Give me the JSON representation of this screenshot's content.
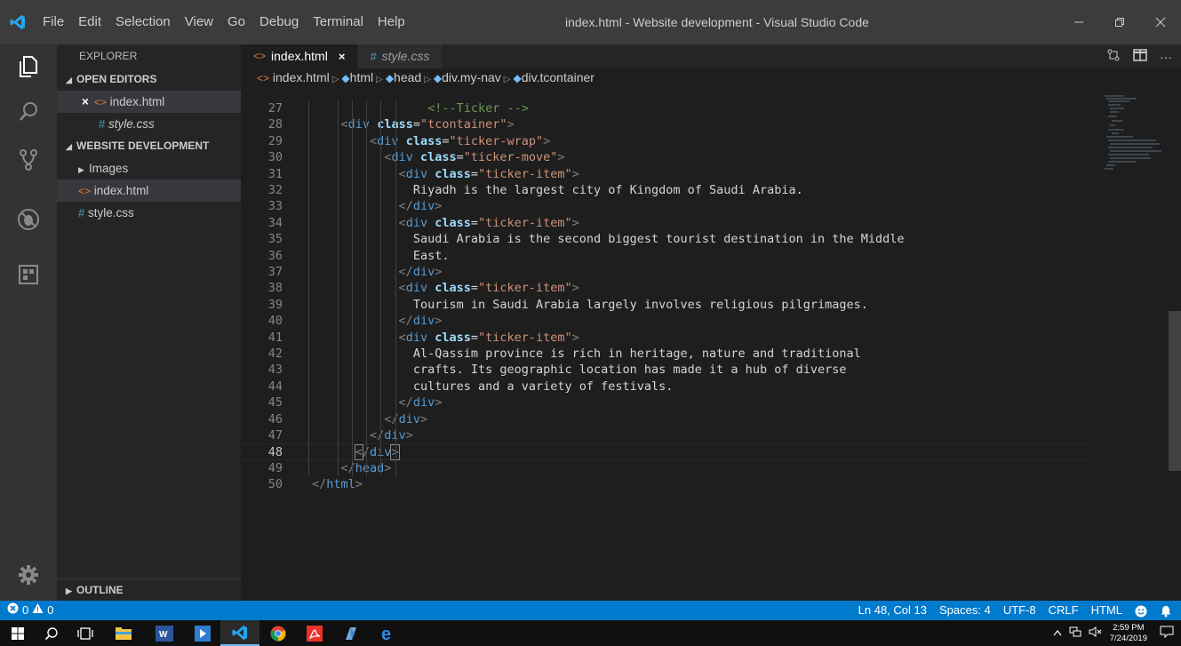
{
  "titlebar": {
    "menu": [
      "File",
      "Edit",
      "Selection",
      "View",
      "Go",
      "Debug",
      "Terminal",
      "Help"
    ],
    "title": "index.html - Website development - Visual Studio Code"
  },
  "sidebar": {
    "title": "EXPLORER",
    "open_editors_label": "OPEN EDITORS",
    "open_editors": [
      {
        "icon": "<>",
        "name": "index.html",
        "close": "×"
      },
      {
        "icon": "#",
        "name": "style.css"
      }
    ],
    "project_label": "WEBSITE DEVELOPMENT",
    "files": [
      {
        "name": "Images",
        "type": "folder"
      },
      {
        "icon": "<>",
        "name": "index.html",
        "type": "html"
      },
      {
        "icon": "#",
        "name": "style.css",
        "type": "css"
      }
    ],
    "outline_label": "OUTLINE"
  },
  "tabs": [
    {
      "icon": "<>",
      "label": "index.html",
      "close": "×",
      "active": true
    },
    {
      "icon": "#",
      "label": "style.css",
      "active": false
    }
  ],
  "breadcrumb": [
    "index.html",
    "html",
    "head",
    "div.my-nav",
    "div.tcontainer"
  ],
  "code_lines": [
    {
      "n": "27",
      "indent": 8,
      "html": "<span class='cm'>&lt;!--Ticker --&gt;</span>"
    },
    {
      "n": "28",
      "indent": 2,
      "html": "<span class='tg'>&lt;</span><span class='tn'>div</span> <span class='an'>class</span><span class='pt'>=</span><span class='av'>\"tcontainer\"</span><span class='tg'>&gt;</span>"
    },
    {
      "n": "29",
      "indent": 4,
      "html": "<span class='tg'>&lt;</span><span class='tn'>div</span> <span class='an'>class</span><span class='pt'>=</span><span class='av'>\"ticker-wrap\"</span><span class='tg'>&gt;</span>"
    },
    {
      "n": "30",
      "indent": 5,
      "html": "<span class='tg'>&lt;</span><span class='tn'>div</span> <span class='an'>class</span><span class='pt'>=</span><span class='av'>\"ticker-move\"</span><span class='tg'>&gt;</span>"
    },
    {
      "n": "31",
      "indent": 6,
      "html": "<span class='tg'>&lt;</span><span class='tn'>div</span> <span class='an'>class</span><span class='pt'>=</span><span class='av'>\"ticker-item\"</span><span class='tg'>&gt;</span>"
    },
    {
      "n": "32",
      "indent": 7,
      "html": "<span class='pt'>Riyadh is the largest city of Kingdom of Saudi Arabia.</span>"
    },
    {
      "n": "33",
      "indent": 6,
      "html": "<span class='tg'>&lt;/</span><span class='tn'>div</span><span class='tg'>&gt;</span>"
    },
    {
      "n": "34",
      "indent": 6,
      "html": "<span class='tg'>&lt;</span><span class='tn'>div</span> <span class='an'>class</span><span class='pt'>=</span><span class='av'>\"ticker-item\"</span><span class='tg'>&gt;</span>"
    },
    {
      "n": "35",
      "indent": 7,
      "html": "<span class='pt'>Saudi Arabia is the second biggest tourist destination in the Middle</span>"
    },
    {
      "n": "36",
      "indent": 7,
      "html": "<span class='pt'>East.</span>"
    },
    {
      "n": "37",
      "indent": 6,
      "html": "<span class='tg'>&lt;/</span><span class='tn'>div</span><span class='tg'>&gt;</span>"
    },
    {
      "n": "38",
      "indent": 6,
      "html": "<span class='tg'>&lt;</span><span class='tn'>div</span> <span class='an'>class</span><span class='pt'>=</span><span class='av'>\"ticker-item\"</span><span class='tg'>&gt;</span>"
    },
    {
      "n": "39",
      "indent": 7,
      "html": "<span class='pt'>Tourism in Saudi Arabia largely involves religious pilgrimages.</span>"
    },
    {
      "n": "40",
      "indent": 6,
      "html": "<span class='tg'>&lt;/</span><span class='tn'>div</span><span class='tg'>&gt;</span>"
    },
    {
      "n": "41",
      "indent": 6,
      "html": "<span class='tg'>&lt;</span><span class='tn'>div</span> <span class='an'>class</span><span class='pt'>=</span><span class='av'>\"ticker-item\"</span><span class='tg'>&gt;</span>"
    },
    {
      "n": "42",
      "indent": 7,
      "html": "<span class='pt'>Al-Qassim province is rich in heritage, nature and traditional</span>"
    },
    {
      "n": "43",
      "indent": 7,
      "html": "<span class='pt'>crafts. Its geographic location has made it a hub of diverse</span>"
    },
    {
      "n": "44",
      "indent": 7,
      "html": "<span class='pt'>cultures and a variety of festivals.</span>"
    },
    {
      "n": "45",
      "indent": 6,
      "html": "<span class='tg'>&lt;/</span><span class='tn'>div</span><span class='tg'>&gt;</span>"
    },
    {
      "n": "46",
      "indent": 5,
      "html": "<span class='tg'>&lt;/</span><span class='tn'>div</span><span class='tg'>&gt;</span>"
    },
    {
      "n": "47",
      "indent": 4,
      "html": "<span class='tg'>&lt;/</span><span class='tn'>div</span><span class='tg'>&gt;</span>"
    },
    {
      "n": "48",
      "indent": 3,
      "html": "<span class='tg bm'>&lt;</span><span class='tg'>/</span><span class='tn'>div</span><span class='tg bm'>&gt;</span>",
      "current": true
    },
    {
      "n": "49",
      "indent": 2,
      "html": "<span class='tg'>&lt;/</span><span class='tn'>head</span><span class='tg'>&gt;</span>"
    },
    {
      "n": "50",
      "indent": 0,
      "html": "<span class='tg'>&lt;/</span><span class='tn'>html</span><span class='tg'>&gt;</span>"
    }
  ],
  "statusbar": {
    "errors": "0",
    "warnings": "0",
    "position": "Ln 48, Col 13",
    "spaces": "Spaces: 4",
    "encoding": "UTF-8",
    "eol": "CRLF",
    "language": "HTML"
  },
  "taskbar": {
    "time": "2:59 PM",
    "date": "7/24/2019"
  },
  "colors": {
    "statusbar": "#007acc",
    "activitybar": "#333333",
    "sidebar": "#252526",
    "editor": "#1e1e1e"
  }
}
